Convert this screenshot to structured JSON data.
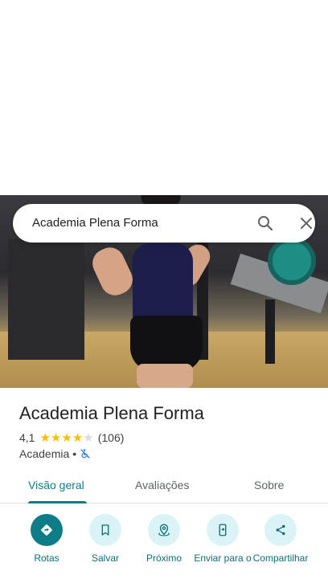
{
  "search": {
    "query": "Academia Plena Forma"
  },
  "place": {
    "name": "Academia Plena Forma",
    "rating": "4,1",
    "rating_value": 4.1,
    "stars_filled": 4,
    "stars_total": 5,
    "review_count": "(106)",
    "category": "Academia",
    "separator": "•"
  },
  "tabs": [
    {
      "label": "Visão geral",
      "active": true
    },
    {
      "label": "Avaliações",
      "active": false
    },
    {
      "label": "Sobre",
      "active": false
    }
  ],
  "actions": [
    {
      "label": "Rotas",
      "icon": "directions-icon",
      "primary": true
    },
    {
      "label": "Salvar",
      "icon": "bookmark-icon",
      "primary": false
    },
    {
      "label": "Próximo",
      "icon": "nearby-icon",
      "primary": false
    },
    {
      "label": "Enviar para o",
      "icon": "send-to-phone-icon",
      "primary": false
    },
    {
      "label": "Compartilhar",
      "icon": "share-icon",
      "primary": false
    }
  ],
  "colors": {
    "accent": "#0e7d88",
    "action_bg": "#d9f3f6",
    "star": "#fbbc04"
  }
}
